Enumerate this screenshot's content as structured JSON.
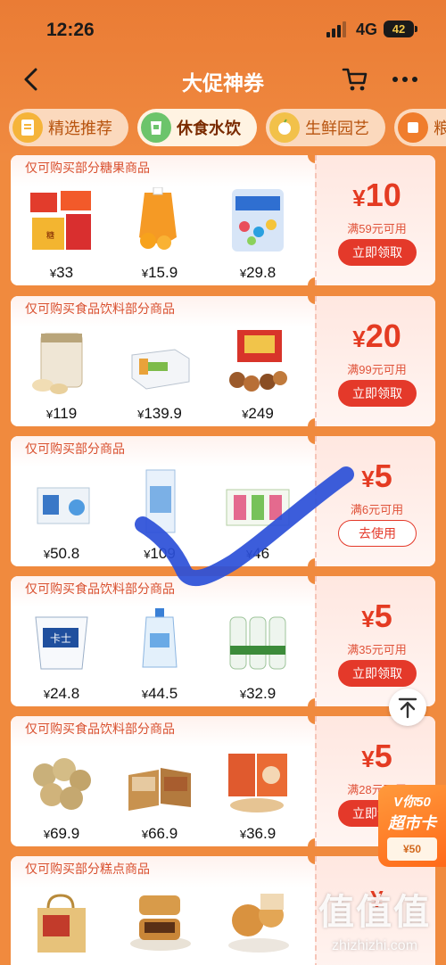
{
  "status": {
    "time": "12:26",
    "network": "4G",
    "battery": "42"
  },
  "nav": {
    "title": "大促神券",
    "back_icon": "chevron-left-icon",
    "cart_icon": "cart-icon",
    "more_icon": "more-dots-icon"
  },
  "tabs": [
    {
      "label": "精选推荐",
      "active": false,
      "icon_color": "#f5b43a"
    },
    {
      "label": "休食水饮",
      "active": true,
      "icon_color": "#6cc46b"
    },
    {
      "label": "生鲜园艺",
      "active": false,
      "icon_color": "#f2c14a"
    },
    {
      "label": "粮",
      "active": false,
      "icon_color": "#f07d2c"
    }
  ],
  "coupons": [
    {
      "scope": "仅可购买部分糖果商品",
      "currency": "¥",
      "amount": "10",
      "condition": "满59元可用",
      "button": "立即领取",
      "button_style": "filled",
      "products": [
        {
          "price": "33"
        },
        {
          "price": "15.9"
        },
        {
          "price": "29.8"
        }
      ]
    },
    {
      "scope": "仅可购买食品饮料部分商品",
      "currency": "¥",
      "amount": "20",
      "condition": "满99元可用",
      "button": "立即领取",
      "button_style": "filled",
      "products": [
        {
          "price": "119"
        },
        {
          "price": "139.9"
        },
        {
          "price": "249"
        }
      ]
    },
    {
      "scope": "仅可购买部分商品",
      "currency": "¥",
      "amount": "5",
      "condition": "满6元可用",
      "button": "去使用",
      "button_style": "outline",
      "products": [
        {
          "price": "50.8"
        },
        {
          "price": "109"
        },
        {
          "price": "46"
        }
      ]
    },
    {
      "scope": "仅可购买食品饮料部分商品",
      "currency": "¥",
      "amount": "5",
      "condition": "满35元可用",
      "button": "立即领取",
      "button_style": "filled",
      "products": [
        {
          "price": "24.8"
        },
        {
          "price": "44.5"
        },
        {
          "price": "32.9"
        }
      ]
    },
    {
      "scope": "仅可购买食品饮料部分商品",
      "currency": "¥",
      "amount": "5",
      "condition": "满28元可用",
      "button": "立即领取",
      "button_style": "filled",
      "products": [
        {
          "price": "69.9"
        },
        {
          "price": "66.9"
        },
        {
          "price": "36.9"
        }
      ]
    },
    {
      "scope": "仅可购买部分糕点商品",
      "currency": "¥",
      "amount": "",
      "condition": "",
      "button": "",
      "button_style": "filled",
      "products": [
        {
          "price": ""
        },
        {
          "price": ""
        },
        {
          "price": ""
        }
      ]
    }
  ],
  "floating": {
    "scroll_top_icon": "arrow-up-to-top-icon",
    "vip_line1": "V你50",
    "vip_line2": "超市卡",
    "vip_badge": "¥50"
  },
  "watermark": {
    "logo": "值值值",
    "site": "zhizhizhi.com"
  },
  "colors": {
    "background": "#f08a3e",
    "accent_red": "#e4392a",
    "tab_active_bg": "#fff3e2"
  }
}
